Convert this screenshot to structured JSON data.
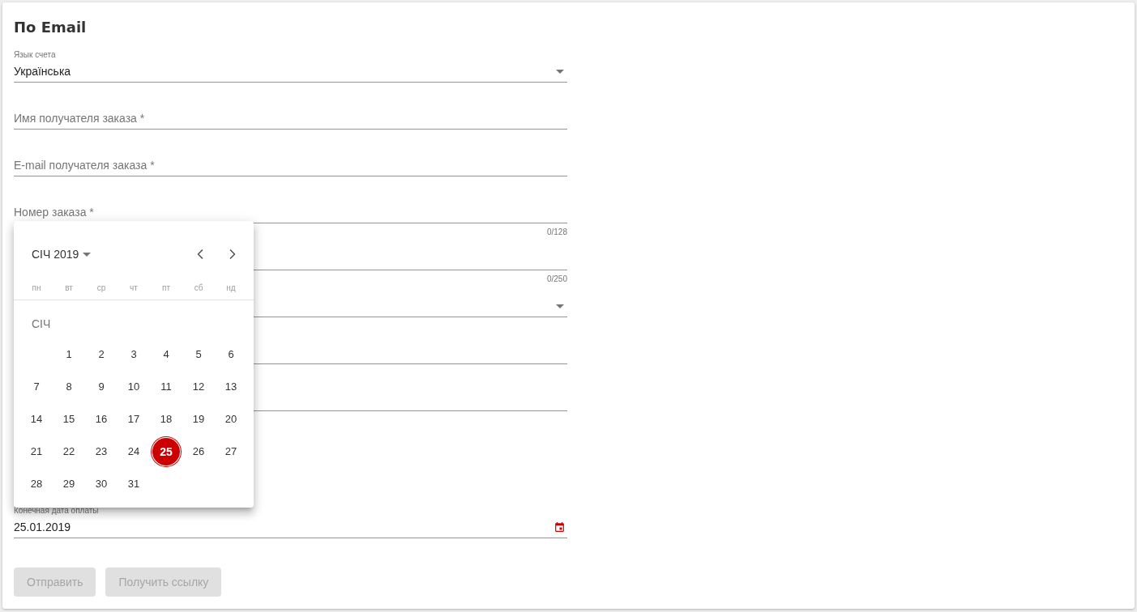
{
  "form": {
    "title": "По Email",
    "fields": [
      {
        "kind": "select",
        "label": "Язык счета",
        "value": "Українська"
      },
      {
        "kind": "text",
        "placeholder": "Имя получателя заказа *"
      },
      {
        "kind": "text",
        "placeholder": "E-mail получателя заказа *"
      },
      {
        "kind": "text",
        "placeholder": "Номер заказа *",
        "counter": "0/128"
      },
      {
        "kind": "text",
        "counter": "0/250"
      },
      {
        "kind": "select"
      },
      {
        "kind": "text"
      },
      {
        "kind": "text"
      }
    ],
    "due_date": {
      "label": "Конечная дата оплаты",
      "value": "25.01.2019"
    },
    "buttons": [
      {
        "label": "Отправить",
        "disabled": true
      },
      {
        "label": "Получить ссылку",
        "disabled": true
      }
    ]
  },
  "date_picker": {
    "title": "СІЧ 2019",
    "weekdays": [
      "пн",
      "вт",
      "ср",
      "чт",
      "пт",
      "сб",
      "нд"
    ],
    "month_heading": "СІЧ",
    "weeks": [
      [
        {
          "label": "1",
          "selected": false
        },
        {
          "label": "2",
          "selected": false
        },
        {
          "label": "3",
          "selected": false
        },
        {
          "label": "4",
          "selected": false
        },
        {
          "label": "5",
          "selected": false
        },
        {
          "label": "6",
          "selected": false
        }
      ],
      [
        {
          "label": "7",
          "selected": false
        },
        {
          "label": "8",
          "selected": false
        },
        {
          "label": "9",
          "selected": false
        },
        {
          "label": "10",
          "selected": false
        },
        {
          "label": "11",
          "selected": false
        },
        {
          "label": "12",
          "selected": false
        },
        {
          "label": "13",
          "selected": false
        }
      ],
      [
        {
          "label": "14",
          "selected": false
        },
        {
          "label": "15",
          "selected": false
        },
        {
          "label": "16",
          "selected": false
        },
        {
          "label": "17",
          "selected": false
        },
        {
          "label": "18",
          "selected": false
        },
        {
          "label": "19",
          "selected": false
        },
        {
          "label": "20",
          "selected": false
        }
      ],
      [
        {
          "label": "21",
          "selected": false
        },
        {
          "label": "22",
          "selected": false
        },
        {
          "label": "23",
          "selected": false
        },
        {
          "label": "24",
          "selected": false
        },
        {
          "label": "25",
          "selected": true
        },
        {
          "label": "26",
          "selected": false
        },
        {
          "label": "27",
          "selected": false
        }
      ],
      [
        {
          "label": "28",
          "selected": false
        },
        {
          "label": "29",
          "selected": false
        },
        {
          "label": "30",
          "selected": false
        },
        {
          "label": "31",
          "selected": false
        }
      ]
    ]
  }
}
